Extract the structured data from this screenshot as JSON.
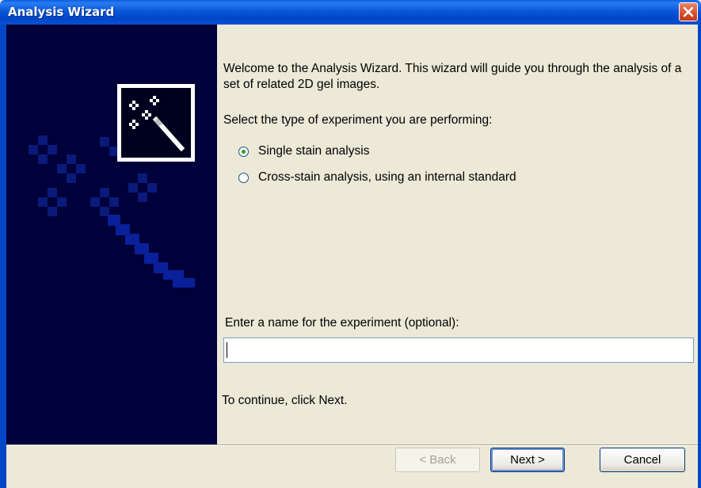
{
  "window": {
    "title": "Analysis Wizard"
  },
  "content": {
    "welcome": "Welcome to the Analysis Wizard. This wizard will guide you through the analysis of a set of related 2D gel images.",
    "select_label": "Select the type of experiment you are performing:",
    "options": [
      {
        "label": "Single stain analysis",
        "checked": true
      },
      {
        "label": "Cross-stain analysis, using an internal standard",
        "checked": false
      }
    ],
    "name_label": "Enter a name for the experiment (optional):",
    "name_value": "",
    "continue_text": "To continue, click Next."
  },
  "buttons": {
    "back": "< Back",
    "next": "Next >",
    "cancel": "Cancel"
  },
  "icons": {
    "close": "close-icon",
    "wizard": "magic-wand-icon"
  },
  "colors": {
    "titlebar": "#0047c8",
    "side_panel": "#00003a",
    "face": "#ece9d8",
    "close": "#d84e2a"
  }
}
